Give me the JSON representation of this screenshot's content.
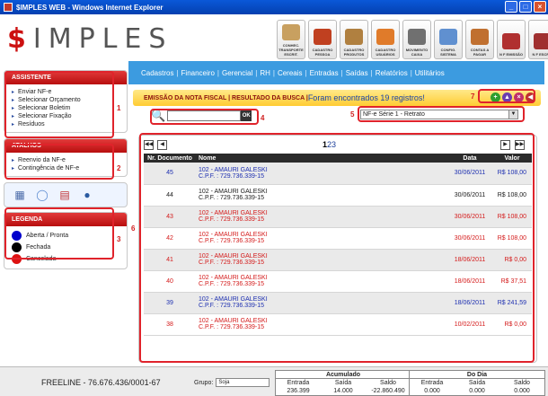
{
  "window": {
    "title": "$IMPLES WEB - Windows Internet Explorer"
  },
  "logo": {
    "dollar": "$",
    "rest": "IMPLES"
  },
  "toolbar": [
    {
      "label": "CONHEC. TRANSPORTE ESCRIT.",
      "color": "#c8a060",
      "icon": "truck-document-icon"
    },
    {
      "label": "CADASTRO PESSOA",
      "color": "#c04020",
      "icon": "person-card-icon"
    },
    {
      "label": "CADASTRO PRODUTOS",
      "color": "#b08040",
      "icon": "box-icon"
    },
    {
      "label": "CADASTRO USUÁRIOS",
      "color": "#e07b2a",
      "icon": "user-icon"
    },
    {
      "label": "MOVIMENTO CAIXA",
      "color": "#707070",
      "icon": "cash-register-icon"
    },
    {
      "label": "CONFIG. SISTEMA",
      "color": "#6090d0",
      "icon": "settings-icon"
    },
    {
      "label": "CONTAS A PAGAR",
      "color": "#c07030",
      "icon": "money-bag-icon"
    },
    {
      "label": "N F EMISSÃO",
      "color": "#b03030",
      "icon": "invoice-icon"
    },
    {
      "label": "N F ESCRIT.",
      "color": "#a03030",
      "icon": "invoice-book-icon"
    }
  ],
  "menu": [
    "Cadastros",
    "Financeiro",
    "Gerencial",
    "RH",
    "Cereais",
    "Entradas",
    "Saídas",
    "Relatórios",
    "Utilitários"
  ],
  "sidebar": {
    "assistente": {
      "title": "ASSISTENTE",
      "items": [
        "Enviar NF-e",
        "Selecionar Orçamento",
        "Selecionar Boletim",
        "Selecionar Fixação",
        "Resíduos"
      ]
    },
    "atalhos": {
      "title": "ATALHOS",
      "items": [
        "Reenvio da NF-e",
        "Contingência de NF-e"
      ]
    },
    "legenda": {
      "title": "LEGENDA",
      "items": [
        {
          "label": "Aberta / Pronta",
          "color": "#0000cc"
        },
        {
          "label": "Fechada",
          "color": "#000000"
        },
        {
          "label": "Cancelada",
          "color": "#dd1111"
        }
      ]
    }
  },
  "annotations": [
    "1",
    "2",
    "3",
    "4",
    "5",
    "6",
    "7"
  ],
  "infobar": {
    "title": "EMISSÃO DA NOTA FISCAL | RESULTADO DA BUSCA |",
    "result": " Foram encontrados 19 registros!"
  },
  "search": {
    "value": "",
    "ok_label": "OK"
  },
  "series_select": {
    "value": "NF-e Série 1 - Retrato"
  },
  "pager": {
    "pages": [
      "1",
      "2",
      "3"
    ]
  },
  "table": {
    "headers": [
      "Nr. Documento",
      "Nome",
      "Data",
      "Valor"
    ],
    "rows": [
      {
        "doc": "45",
        "name": "102 - AMAURI GALESKI",
        "cpf": "C.P.F. : 729.736.339-15",
        "date": "30/06/2011",
        "value": "R$ 108,00",
        "status": "blue"
      },
      {
        "doc": "44",
        "name": "102 - AMAURI GALESKI",
        "cpf": "C.P.F. : 729.736.339-15",
        "date": "30/06/2011",
        "value": "R$ 108,00",
        "status": "black"
      },
      {
        "doc": "43",
        "name": "102 - AMAURI GALESKI",
        "cpf": "C.P.F. : 729.736.339-15",
        "date": "30/06/2011",
        "value": "R$ 108,00",
        "status": "red"
      },
      {
        "doc": "42",
        "name": "102 - AMAURI GALESKI",
        "cpf": "C.P.F. : 729.736.339-15",
        "date": "30/06/2011",
        "value": "R$ 108,00",
        "status": "red"
      },
      {
        "doc": "41",
        "name": "102 - AMAURI GALESKI",
        "cpf": "C.P.F. : 729.736.339-15",
        "date": "18/06/2011",
        "value": "R$ 0,00",
        "status": "red"
      },
      {
        "doc": "40",
        "name": "102 - AMAURI GALESKI",
        "cpf": "C.P.F. : 729.736.339-15",
        "date": "18/06/2011",
        "value": "R$ 37,51",
        "status": "red"
      },
      {
        "doc": "39",
        "name": "102 - AMAURI GALESKI",
        "cpf": "C.P.F. : 729.736.339-15",
        "date": "18/06/2011",
        "value": "R$ 241,59",
        "status": "blue"
      },
      {
        "doc": "38",
        "name": "102 - AMAURI GALESKI",
        "cpf": "C.P.F. : 729.736.339-15",
        "date": "10/02/2011",
        "value": "R$ 0,00",
        "status": "red"
      }
    ]
  },
  "colors": {
    "blue": "#1d2fb0",
    "black": "#1a1a1a",
    "red": "#d41a1a"
  },
  "footer": {
    "company": "FREELINE - 76.676.436/0001-67",
    "group_label": "Grupo:",
    "group_value": "Soja",
    "acumulado": {
      "title": "Acumulado",
      "cols": [
        "Entrada",
        "Saída",
        "Saldo"
      ],
      "values": [
        "236.399",
        "14.000",
        "-22.860.490"
      ]
    },
    "dodia": {
      "title": "Do Dia",
      "cols": [
        "Entrada",
        "Saída",
        "Saldo"
      ],
      "values": [
        "0.000",
        "0.000",
        "0.000"
      ]
    }
  }
}
